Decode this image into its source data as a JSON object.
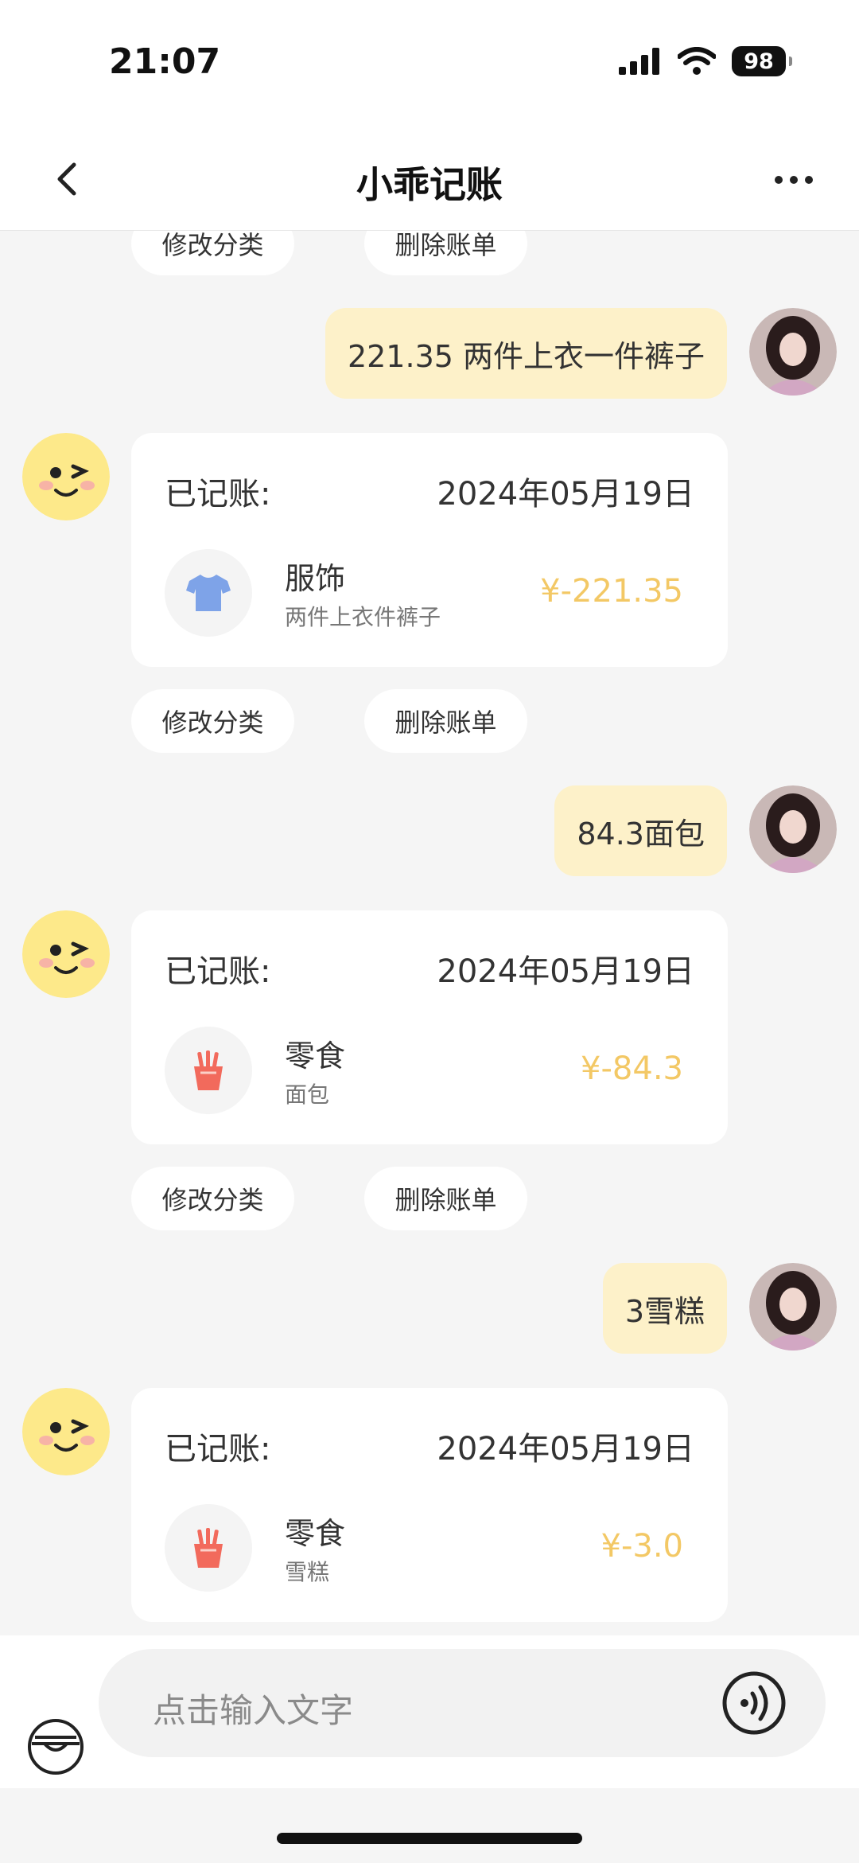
{
  "status": {
    "time": "21:07",
    "battery": "98"
  },
  "nav": {
    "title": "小乖记账"
  },
  "colors": {
    "accent": "#f3c865",
    "user_bubble": "#fdf1c9"
  },
  "actions": {
    "edit_category": "修改分类",
    "delete_bill": "删除账单"
  },
  "messages": [
    {
      "user_text": "221.35 两件上衣一件裤子",
      "label": "已记账:",
      "date": "2024年05月19日",
      "category": "服饰",
      "category_icon": "tshirt-icon",
      "note": "两件上衣件裤子",
      "amount": "¥-221.35"
    },
    {
      "user_text": "84.3面包",
      "label": "已记账:",
      "date": "2024年05月19日",
      "category": "零食",
      "category_icon": "fries-icon",
      "note": "面包",
      "amount": "¥-84.3"
    },
    {
      "user_text": "3雪糕",
      "label": "已记账:",
      "date": "2024年05月19日",
      "category": "零食",
      "category_icon": "fries-icon",
      "note": "雪糕",
      "amount": "¥-3.0"
    }
  ],
  "input": {
    "placeholder": "点击输入文字"
  }
}
